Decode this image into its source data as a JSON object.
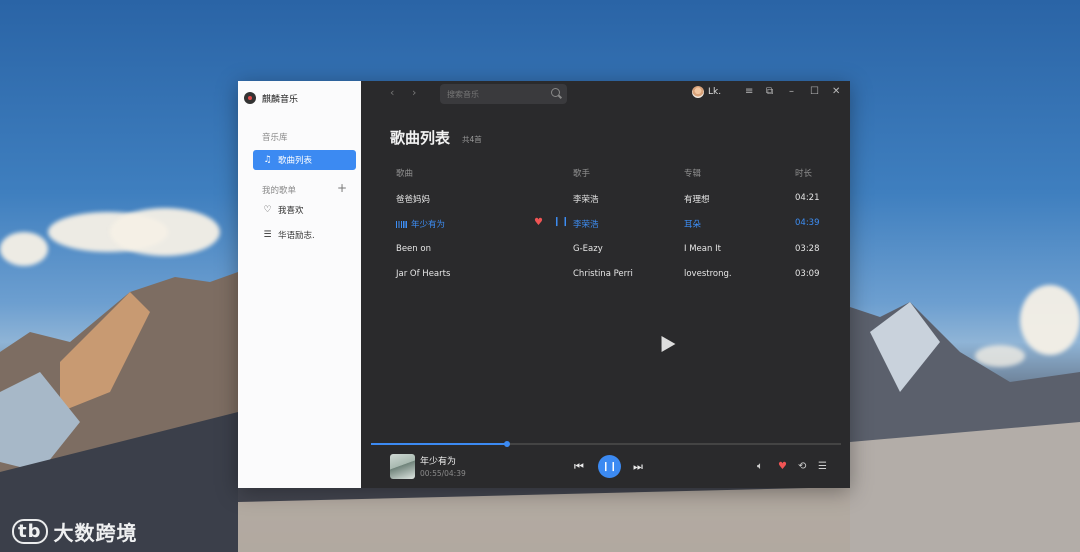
{
  "app": {
    "name": "麒麟音乐"
  },
  "sidebar": {
    "library_label": "音乐库",
    "items": [
      {
        "label": "歌曲列表",
        "icon": "music-note-icon"
      }
    ],
    "playlists_label": "我的歌单",
    "playlists": [
      {
        "label": "我喜欢",
        "icon": "heart-outline-icon"
      },
      {
        "label": "华语励志.",
        "icon": "playlist-icon"
      }
    ]
  },
  "header": {
    "search_placeholder": "搜索音乐",
    "user_name": "Lk."
  },
  "page": {
    "title": "歌曲列表",
    "count": "共4首"
  },
  "table": {
    "columns": [
      "歌曲",
      "歌手",
      "专辑",
      "时长"
    ],
    "rows": [
      {
        "song": "爸爸妈妈",
        "artist": "李荣浩",
        "album": "有理想",
        "duration": "04:21",
        "playing": false
      },
      {
        "song": "年少有为",
        "artist": "李荣浩",
        "album": "耳朵",
        "duration": "04:39",
        "playing": true
      },
      {
        "song": "Been on",
        "artist": "G-Eazy",
        "album": "I Mean It",
        "duration": "03:28",
        "playing": false
      },
      {
        "song": "Jar Of Hearts",
        "artist": "Christina Perri",
        "album": "lovestrong.",
        "duration": "03:09",
        "playing": false
      }
    ]
  },
  "player": {
    "title": "年少有为",
    "time": "00:55/04:39",
    "progress": 0.29
  },
  "watermark": "大数跨境",
  "colors": {
    "accent": "#3c8af2",
    "heart": "#f05454",
    "panel": "#2a2a2c"
  }
}
